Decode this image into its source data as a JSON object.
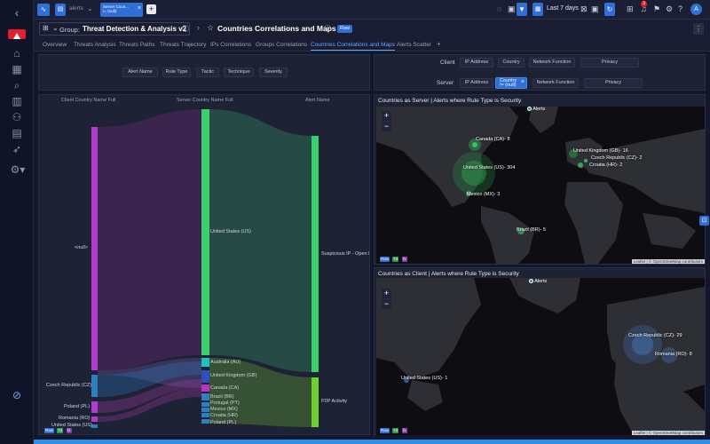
{
  "topbar": {
    "breadcrumb_label": "alerts",
    "filter_chip_line1": "Server Coun...",
    "filter_chip_line2": "!= (null)",
    "time_range": "Last 7 days",
    "notification_count": "3",
    "avatar_letter": "A"
  },
  "header": {
    "group_prefix": "Group:",
    "group_name": "Threat Detection & Analysis v2",
    "page_title": "Countries Correlations and Maps",
    "raw_badge": "Raw"
  },
  "tabs": [
    {
      "label": "Overview"
    },
    {
      "label": "Threats Analysis"
    },
    {
      "label": "Threats Paths"
    },
    {
      "label": "Threats Trajectory"
    },
    {
      "label": "IPs Correlations"
    },
    {
      "label": "Groups Correlations"
    },
    {
      "label": "Countries Correlations and Maps"
    },
    {
      "label": "Alerts Scatter"
    }
  ],
  "left_filters": [
    "Alert Name",
    "Rule Type",
    "Tactic",
    "Technique",
    "Severity"
  ],
  "client_row": {
    "label": "Client",
    "buttons": [
      "IP Address",
      "Country",
      "Network Function",
      "Privacy"
    ]
  },
  "server_row": {
    "label": "Server",
    "buttons": [
      "IP Address",
      "Country",
      "Network Function",
      "Privacy"
    ],
    "selected_line1": "Country",
    "selected_line2": "!= (null)"
  },
  "sankey": {
    "col_headers": [
      "Client Country Name Full",
      "Server Country Name Full",
      "Alert Name"
    ],
    "client_nodes": [
      "<null>",
      "Czech Republic (CZ)",
      "Poland (PL)",
      "Romania (RO)",
      "United States (US)"
    ],
    "server_nodes": [
      "United States (US)",
      "Australia (AU)",
      "United Kingdom (GB)",
      "Canada (CA)",
      "Brazil (BR)",
      "Portugal (PT)",
      "Mexico (MX)",
      "Croatia (HR)",
      "Poland (PL)"
    ],
    "alert_nodes": [
      "Suspicious IP - Open D",
      "P2P Activity"
    ]
  },
  "badges": [
    "Raw",
    "7d",
    "fx"
  ],
  "map1": {
    "title": "Countries as Server | Alerts where Rule Type is Security",
    "legend": "Alerts",
    "labels": [
      "Canada (CA)- 8",
      "United States (US)- 304",
      "Mexico (MX)- 3",
      "United Kingdom (GB)- 16",
      "Czech Republic (CZ)- 2",
      "Croatia (HR)- 2",
      "Brazil (BR)- 5"
    ],
    "attribution": "Leaflet | © OpenStreetMap contributors"
  },
  "map2": {
    "title": "Countries as Client | Alerts where Rule Type is Security",
    "legend": "Alerts",
    "labels": [
      "Czech Republic (CZ)- 29",
      "Romania (RO)- 8",
      "United States (US)- 1"
    ],
    "attribution": "Leaflet | © OpenStreetMap contributors"
  },
  "zoom": {
    "in": "+",
    "out": "−"
  }
}
